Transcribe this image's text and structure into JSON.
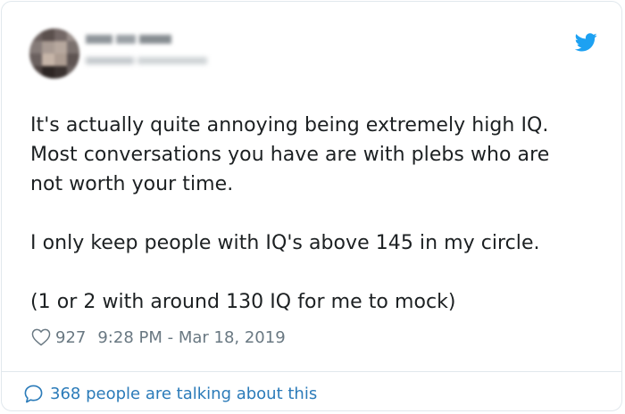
{
  "tweet": {
    "author_name": "",
    "author_handle": "",
    "text_paragraphs": [
      "It's actually quite annoying being extremely high IQ.\nMost conversations you have are with plebs who are\nnot worth your time.",
      "I only keep people with IQ's above 145 in my circle.",
      "(1 or 2 with around 130 IQ for me to mock)"
    ],
    "likes": "927",
    "timestamp": "9:28 PM - Mar 18, 2019",
    "talking_about": "368 people are talking about this"
  },
  "icons": {
    "brand": "twitter-bird-icon",
    "like": "heart-outline-icon",
    "reply": "speech-bubble-icon"
  },
  "colors": {
    "twitter_blue": "#1da1f2",
    "link_blue": "#2b7bb9",
    "text": "#1c2022",
    "muted": "#697882",
    "border": "#e1e8ed"
  }
}
